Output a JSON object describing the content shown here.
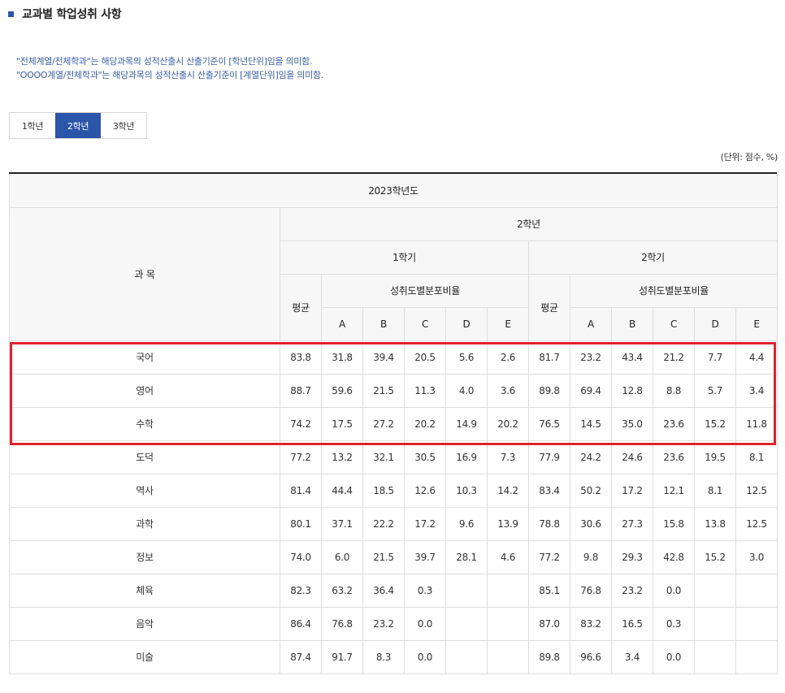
{
  "page": {
    "title": "교과별 학업성취 사항",
    "notes": [
      "\"전체계열/전체학과\"는 해당과목의 성적산출시 산출기준이 [학년단위]임을 의미함.",
      "\"OOOO계열/전체학과\"는 해당과목의 성적산출시 산출기준이 [계열단위]임을 의미함."
    ]
  },
  "tabs": [
    {
      "label": "1학년",
      "active": false
    },
    {
      "label": "2학년",
      "active": true
    },
    {
      "label": "3학년",
      "active": false
    }
  ],
  "unit_label": "(단위: 점수, %)",
  "table": {
    "year": "2023학년도",
    "grade": "2학년",
    "subject_header": "과 목",
    "semester1": "1학기",
    "semester2": "2학기",
    "avg_label": "평균",
    "dist_label": "성취도별분포비율",
    "levels": [
      "A",
      "B",
      "C",
      "D",
      "E"
    ],
    "rows": [
      {
        "subject": "국어",
        "s1": [
          "83.8",
          "31.8",
          "39.4",
          "20.5",
          "5.6",
          "2.6"
        ],
        "s2": [
          "81.7",
          "23.2",
          "43.4",
          "21.2",
          "7.7",
          "4.4"
        ]
      },
      {
        "subject": "영어",
        "s1": [
          "88.7",
          "59.6",
          "21.5",
          "11.3",
          "4.0",
          "3.6"
        ],
        "s2": [
          "89.8",
          "69.4",
          "12.8",
          "8.8",
          "5.7",
          "3.4"
        ]
      },
      {
        "subject": "수학",
        "s1": [
          "74.2",
          "17.5",
          "27.2",
          "20.2",
          "14.9",
          "20.2"
        ],
        "s2": [
          "76.5",
          "14.5",
          "35.0",
          "23.6",
          "15.2",
          "11.8"
        ]
      },
      {
        "subject": "도덕",
        "s1": [
          "77.2",
          "13.2",
          "32.1",
          "30.5",
          "16.9",
          "7.3"
        ],
        "s2": [
          "77.9",
          "24.2",
          "24.6",
          "23.6",
          "19.5",
          "8.1"
        ]
      },
      {
        "subject": "역사",
        "s1": [
          "81.4",
          "44.4",
          "18.5",
          "12.6",
          "10.3",
          "14.2"
        ],
        "s2": [
          "83.4",
          "50.2",
          "17.2",
          "12.1",
          "8.1",
          "12.5"
        ]
      },
      {
        "subject": "과학",
        "s1": [
          "80.1",
          "37.1",
          "22.2",
          "17.2",
          "9.6",
          "13.9"
        ],
        "s2": [
          "78.8",
          "30.6",
          "27.3",
          "15.8",
          "13.8",
          "12.5"
        ]
      },
      {
        "subject": "정보",
        "s1": [
          "74.0",
          "6.0",
          "21.5",
          "39.7",
          "28.1",
          "4.6"
        ],
        "s2": [
          "77.2",
          "9.8",
          "29.3",
          "42.8",
          "15.2",
          "3.0"
        ]
      },
      {
        "subject": "체육",
        "s1": [
          "82.3",
          "63.2",
          "36.4",
          "0.3",
          "",
          ""
        ],
        "s2": [
          "85.1",
          "76.8",
          "23.2",
          "0.0",
          "",
          ""
        ]
      },
      {
        "subject": "음악",
        "s1": [
          "86.4",
          "76.8",
          "23.2",
          "0.0",
          "",
          ""
        ],
        "s2": [
          "87.0",
          "83.2",
          "16.5",
          "0.3",
          "",
          ""
        ]
      },
      {
        "subject": "미술",
        "s1": [
          "87.4",
          "91.7",
          "8.3",
          "0.0",
          "",
          ""
        ],
        "s2": [
          "89.8",
          "96.6",
          "3.4",
          "0.0",
          "",
          ""
        ]
      }
    ]
  },
  "colors": {
    "accent": "#2b55a8",
    "highlight": "#e0232e",
    "header_bg": "#f7f7f7",
    "border": "#dedede"
  }
}
